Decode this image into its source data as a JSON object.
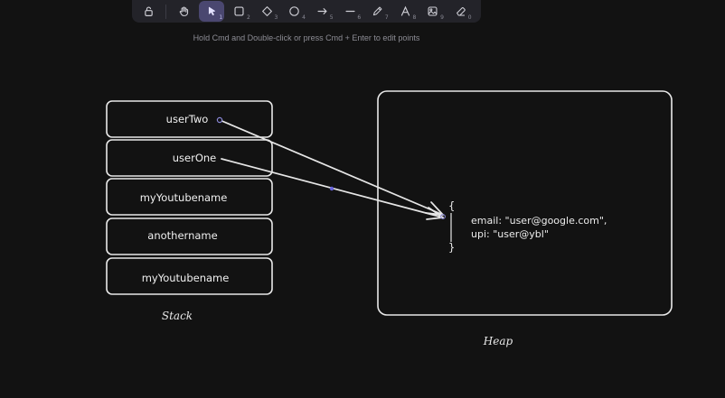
{
  "toolbar": {
    "tools": [
      {
        "name": "lock",
        "key": ""
      },
      {
        "name": "hand",
        "key": ""
      },
      {
        "name": "selection",
        "key": "1",
        "active": true
      },
      {
        "name": "rectangle",
        "key": "2"
      },
      {
        "name": "diamond",
        "key": "3"
      },
      {
        "name": "ellipse",
        "key": "4"
      },
      {
        "name": "arrow",
        "key": "5"
      },
      {
        "name": "line",
        "key": "6"
      },
      {
        "name": "draw",
        "key": "7"
      },
      {
        "name": "text",
        "key": "8"
      },
      {
        "name": "image",
        "key": "9"
      },
      {
        "name": "eraser",
        "key": "0"
      }
    ],
    "accent": "#4a4770"
  },
  "hint": "Hold Cmd and Double-click or press Cmd + Enter to edit points",
  "stack": {
    "label": "Stack",
    "cells": [
      "userTwo",
      "userOne",
      "myYoutubename",
      "anothername",
      "myYoutubename"
    ]
  },
  "heap": {
    "label": "Heap",
    "open_brace": "{",
    "close_brace": "}",
    "lines": [
      "email: \"user@google.com\",",
      "upi: \"user@ybl\""
    ]
  },
  "colors": {
    "background": "#121212",
    "stroke": "#e8e8e8",
    "selection": "#6965db"
  }
}
